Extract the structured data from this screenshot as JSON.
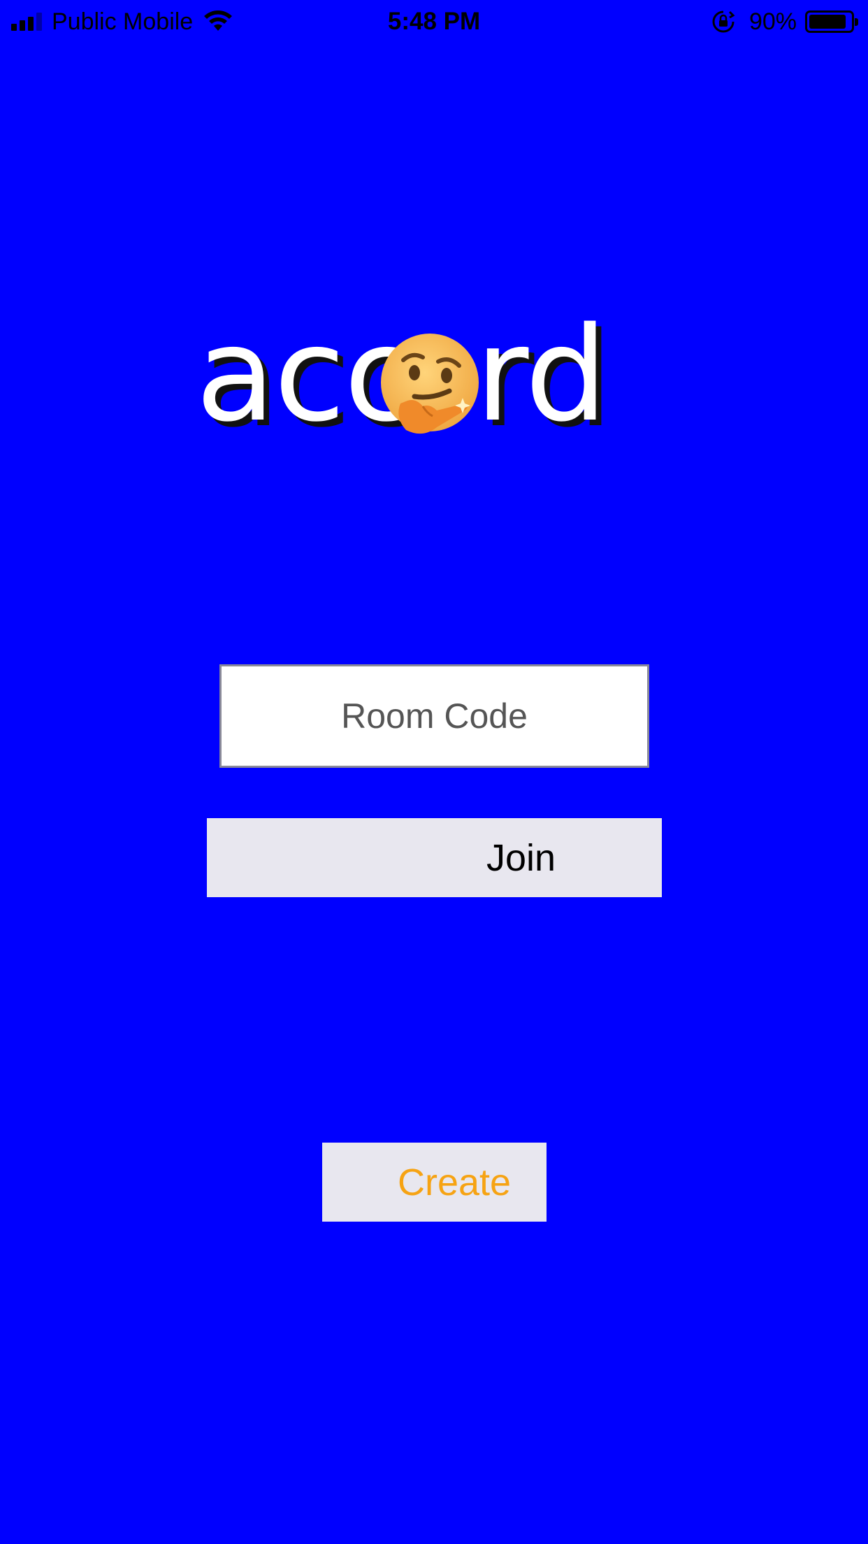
{
  "status_bar": {
    "carrier": "Public Mobile",
    "time": "5:48 PM",
    "battery_percent": "90%",
    "battery_level": 0.9,
    "icons": [
      "cellular-signal-icon",
      "wifi-icon",
      "rotation-lock-icon",
      "battery-icon"
    ]
  },
  "logo": {
    "text": "acc",
    "text_suffix": "rd",
    "emoji_name": "thinking-face-emoji"
  },
  "room_code": {
    "placeholder": "Room Code",
    "value": ""
  },
  "join_label": "Join",
  "create_label": "Create",
  "colors": {
    "background": "#0000ff",
    "button_bg": "#e8e7ef",
    "create_text": "#f6a313",
    "join_text": "#000000",
    "input_border": "#8a8a99"
  }
}
